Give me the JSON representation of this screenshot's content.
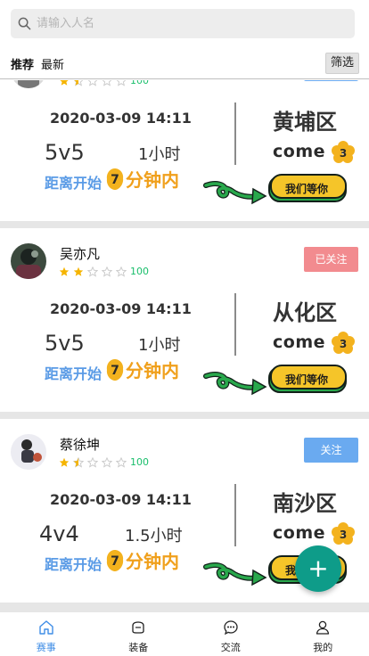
{
  "search": {
    "placeholder": "请输入人名"
  },
  "tabs": [
    {
      "label": "推荐",
      "active": true
    },
    {
      "label": "最新",
      "active": false
    }
  ],
  "filter_label": "筛选",
  "cards": [
    {
      "name": "",
      "stars": 1.5,
      "score": "100",
      "follow_label": "",
      "follow_state": "follow",
      "datetime": "2020-03-09 14:11",
      "mode": "5v5",
      "duration": "1小时",
      "start_label": "距离开始",
      "countdown_badge": "7",
      "countdown_unit": "分钟内",
      "district": "黄埔区",
      "come_text": "come",
      "come_badge": "3",
      "wait_label": "我们等你"
    },
    {
      "name": "吴亦凡",
      "stars": 2,
      "score": "100",
      "follow_label": "已关注",
      "follow_state": "followed",
      "datetime": "2020-03-09 14:11",
      "mode": "5v5",
      "duration": "1小时",
      "start_label": "距离开始",
      "countdown_badge": "7",
      "countdown_unit": "分钟内",
      "district": "从化区",
      "come_text": "come",
      "come_badge": "3",
      "wait_label": "我们等你"
    },
    {
      "name": "蔡徐坤",
      "stars": 1.5,
      "score": "100",
      "follow_label": "关注",
      "follow_state": "follow",
      "datetime": "2020-03-09 14:11",
      "mode": "4v4",
      "duration": "1.5小时",
      "start_label": "距离开始",
      "countdown_badge": "7",
      "countdown_unit": "分钟内",
      "district": "南沙区",
      "come_text": "come",
      "come_badge": "3",
      "wait_label": "我们等你"
    }
  ],
  "fab_label": "+",
  "nav": [
    {
      "label": "赛事",
      "icon": "home-icon",
      "active": true
    },
    {
      "label": "装备",
      "icon": "gear-bag-icon",
      "active": false
    },
    {
      "label": "交流",
      "icon": "chat-icon",
      "active": false
    },
    {
      "label": "我的",
      "icon": "user-icon",
      "active": false
    }
  ],
  "colors": {
    "accent": "#3f8de6",
    "followed": "#f28b8f",
    "follow": "#6aaaf0",
    "score": "#19be6b",
    "countdown": "#f0a01c",
    "fab": "#0e9c89"
  }
}
